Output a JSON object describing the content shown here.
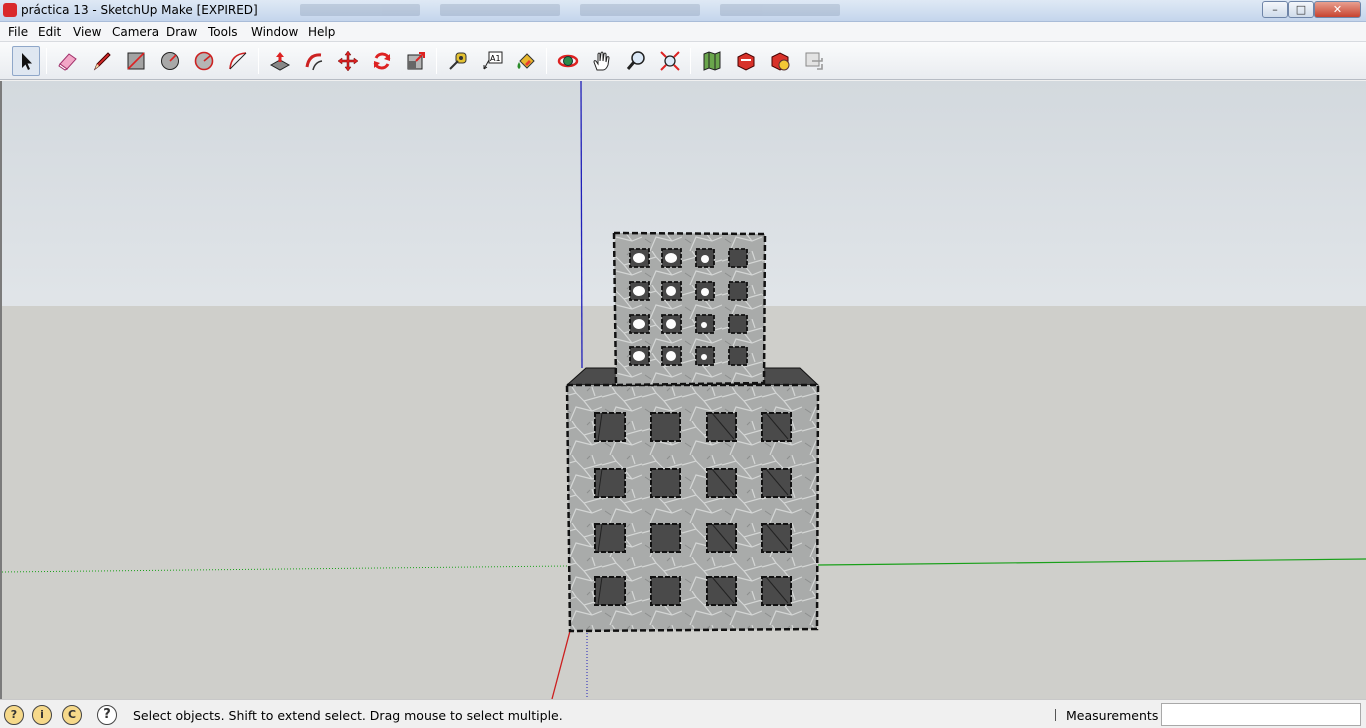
{
  "window": {
    "title": "práctica 13 - SketchUp Make [EXPIRED]",
    "minimize": "–",
    "maximize": "□",
    "close": "✕"
  },
  "menu": [
    "File",
    "Edit",
    "View",
    "Camera",
    "Draw",
    "Tools",
    "Window",
    "Help"
  ],
  "toolbar": {
    "tools": [
      {
        "name": "select-tool",
        "icon": "arrow-cursor-icon",
        "active": true
      },
      {
        "name": "eraser-tool",
        "icon": "eraser-icon"
      },
      {
        "name": "pencil-tool",
        "icon": "pencil-icon"
      },
      {
        "name": "rectangle-tool",
        "icon": "rectangle-icon"
      },
      {
        "name": "circle-tool",
        "icon": "circle-icon"
      },
      {
        "name": "polygon-tool",
        "icon": "polygon-icon"
      },
      {
        "name": "arc-tool",
        "icon": "arc-icon"
      },
      {
        "name": "push-pull-tool",
        "icon": "push-pull-icon"
      },
      {
        "name": "follow-me-tool",
        "icon": "follow-me-icon"
      },
      {
        "name": "move-tool",
        "icon": "move-arrows-icon"
      },
      {
        "name": "rotate-tool",
        "icon": "rotate-icon"
      },
      {
        "name": "scale-tool",
        "icon": "scale-icon"
      },
      {
        "name": "tape-measure-tool",
        "icon": "tape-measure-icon"
      },
      {
        "name": "text-tool",
        "icon": "text-label-icon"
      },
      {
        "name": "paint-bucket-tool",
        "icon": "paint-bucket-icon"
      },
      {
        "name": "orbit-tool",
        "icon": "orbit-icon"
      },
      {
        "name": "pan-tool",
        "icon": "hand-icon"
      },
      {
        "name": "zoom-tool",
        "icon": "magnifier-icon"
      },
      {
        "name": "zoom-extents-tool",
        "icon": "zoom-extents-icon"
      },
      {
        "name": "add-location-tool",
        "icon": "map-location-icon"
      },
      {
        "name": "get-models-tool",
        "icon": "3d-warehouse-icon"
      },
      {
        "name": "share-model-tool",
        "icon": "share-model-icon"
      },
      {
        "name": "extension-warehouse-tool",
        "icon": "extension-icon"
      }
    ],
    "text_tool_glyph": "A1"
  },
  "status": {
    "icons": [
      "geo-location-icon",
      "credits-icon",
      "copyright-icon",
      "help-icon"
    ],
    "icon_glyphs": [
      "?",
      "i",
      "C",
      "?"
    ],
    "message": "Select objects. Shift to extend select. Drag mouse to select multiple.",
    "measurements_label": "Measurements",
    "measurements_value": ""
  },
  "colors": {
    "axis_blue": "#1f1fb8",
    "axis_green": "#1aa01a",
    "axis_red": "#cc1f1f",
    "sky_top": "#d3d9de",
    "ground": "#cfcfcb",
    "stone": "#a9abaa",
    "window_dark": "#4a4a4a"
  }
}
